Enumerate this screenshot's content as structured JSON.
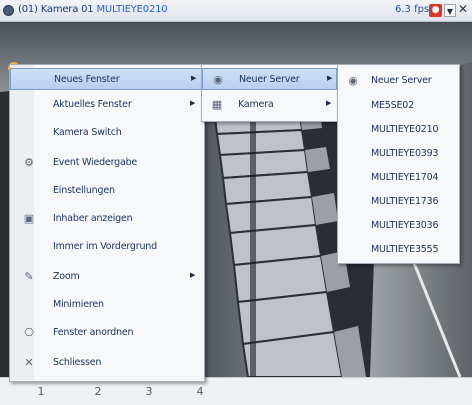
{
  "window": {
    "title_prefix": "(01) Kamera 01",
    "title_device": "MULTIEYE0210",
    "fps": "6.3 fps"
  },
  "bottom": {
    "pages": [
      "1",
      "2",
      "3",
      "4"
    ]
  },
  "context_menu": {
    "items": [
      {
        "label": "Neues Fenster",
        "icon": "none",
        "submenu": true
      },
      {
        "label": "Aktuelles Fenster",
        "icon": "none",
        "submenu": true
      },
      {
        "label": "Kamera Switch",
        "icon": "none",
        "submenu": false
      },
      {
        "label": "Event Wiedergabe",
        "icon": "event-playback-icon",
        "submenu": false
      },
      {
        "label": "Einstellungen",
        "icon": "none",
        "submenu": false
      },
      {
        "label": "Inhaber anzeigen",
        "icon": "display-icon",
        "submenu": false
      },
      {
        "label": "Immer im Vordergrund",
        "icon": "none",
        "submenu": false
      },
      {
        "label": "Zoom",
        "icon": "zoom-icon",
        "submenu": true
      },
      {
        "label": "Minimieren",
        "icon": "none",
        "submenu": false
      },
      {
        "label": "Fenster anordnen",
        "icon": "arrange-icon",
        "submenu": false
      },
      {
        "label": "Schliessen",
        "icon": "close-icon",
        "submenu": false
      }
    ]
  },
  "submenu_neues_fenster": {
    "items": [
      {
        "label": "Neuer Server",
        "icon": "server-icon",
        "submenu": true
      },
      {
        "label": "Kamera",
        "icon": "camera-icon",
        "submenu": true
      }
    ]
  },
  "submenu_neuer_server": {
    "items": [
      {
        "label": "Neuer Server",
        "icon": "server-icon"
      },
      {
        "label": "ME5SE02"
      },
      {
        "label": "MULTIEYE0210"
      },
      {
        "label": "MULTIEYE0393"
      },
      {
        "label": "MULTIEYE1704"
      },
      {
        "label": "MULTIEYE1736"
      },
      {
        "label": "MULTIEYE3036"
      },
      {
        "label": "MULTIEYE3555"
      }
    ]
  }
}
